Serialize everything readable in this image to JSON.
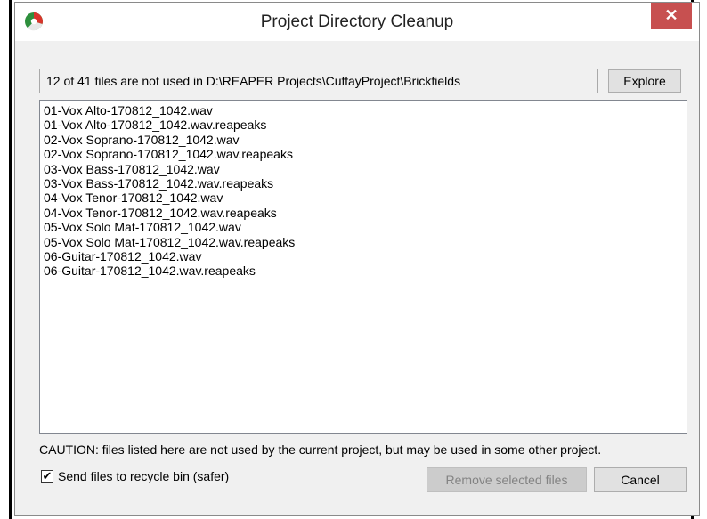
{
  "window": {
    "title": "Project Directory Cleanup",
    "close_glyph": "✕",
    "icon": "reaper-app-icon",
    "accent_close": "#c75050"
  },
  "path_info": "12 of 41 files are not used in D:\\REAPER Projects\\CuffayProject\\Brickfields",
  "buttons": {
    "explore": "Explore",
    "remove": "Remove selected files",
    "cancel": "Cancel"
  },
  "files": [
    "01-Vox Alto-170812_1042.wav",
    "01-Vox Alto-170812_1042.wav.reapeaks",
    "02-Vox Soprano-170812_1042.wav",
    "02-Vox Soprano-170812_1042.wav.reapeaks",
    "03-Vox Bass-170812_1042.wav",
    "03-Vox Bass-170812_1042.wav.reapeaks",
    "04-Vox Tenor-170812_1042.wav",
    "04-Vox Tenor-170812_1042.wav.reapeaks",
    "05-Vox Solo Mat-170812_1042.wav",
    "05-Vox Solo Mat-170812_1042.wav.reapeaks",
    "06-Guitar-170812_1042.wav",
    "06-Guitar-170812_1042.wav.reapeaks"
  ],
  "caution": "CAUTION: files listed here are not used by the current project, but may be used in some other project.",
  "recycle": {
    "label": "Send files to recycle bin (safer)",
    "checked_glyph": "✔"
  }
}
